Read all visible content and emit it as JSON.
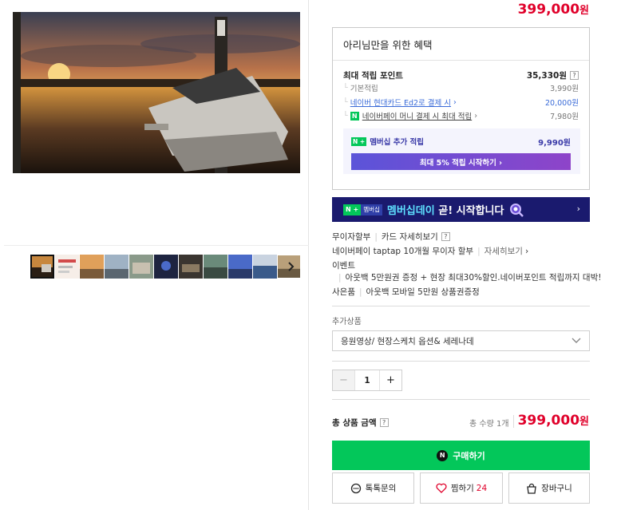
{
  "price_top": {
    "amount": "399,000",
    "won": "원"
  },
  "gallery": {
    "next_label": "›"
  },
  "benefits": {
    "title": "아리님만을 위한 혜택",
    "max_points_label": "최대 적립 포인트",
    "max_points_value": "35,330원",
    "help": "?",
    "rows": [
      {
        "label": "기본적립",
        "value": "3,990원"
      },
      {
        "label": "네이버 현대카드 Ed2로 결제 시",
        "value": "20,000원"
      },
      {
        "label": "네이버페이 머니 결제 시 최대 적립",
        "value": "7,980원",
        "badge": "N"
      }
    ],
    "membership": {
      "badge": "N +",
      "label": "멤버십 추가 적립",
      "value": "9,990원",
      "button": "최대 5% 적립 시작하기 ›"
    }
  },
  "banner": {
    "badge1": "N +",
    "badge2": "멤버십",
    "text_highlight": "멤버십데이",
    "text_rest": " 곧! 시작합니다",
    "arrow": "›"
  },
  "info": {
    "installment": "무이자할부",
    "card_detail": "카드 자세히보기",
    "help": "?",
    "npay_taptap": "네이버페이 taptap 10개월 무이자 할부",
    "detail": "자세히보기",
    "event_label": "이벤트",
    "event_text": "아웃백 5만원권 증정 + 현장 최대30%할인.네이버포인트 적립까지 대박!",
    "gift_label": "사은품",
    "gift_text": "아웃백 모바일 5만원 상품권증정"
  },
  "addon": {
    "label": "추가상품",
    "selected": "응원영상/ 현장스케치 옵션& 세레나데"
  },
  "quantity": {
    "minus": "−",
    "value": "1",
    "plus": "+"
  },
  "total": {
    "label": "총 상품 금액",
    "help": "?",
    "count": "총 수량 1개",
    "amount": "399,000",
    "won": "원"
  },
  "actions": {
    "buy": "구매하기",
    "buy_icon": "N",
    "talk": "톡톡문의",
    "like": "찜하기",
    "like_count": "24",
    "cart": "장바구니"
  },
  "colors": {
    "accent_red": "#e0002a",
    "naver_green": "#03c75a",
    "banner_navy": "#1a1a6e",
    "link_blue": "#3a6bd8"
  }
}
